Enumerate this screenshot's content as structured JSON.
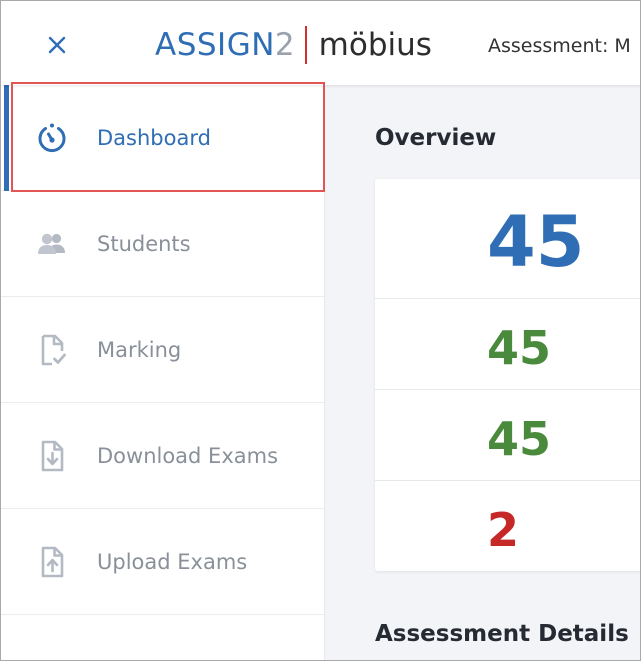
{
  "header": {
    "close_icon": "close-icon",
    "logo": {
      "assign_text": "ASSIGN",
      "assign_number": "2",
      "product_text": "möbius",
      "brand_blue": "#2f6db5",
      "divider_red": "#d32f2f"
    },
    "crumb": "Assessment: M"
  },
  "sidebar": {
    "active_color": "#2f6db5",
    "items": [
      {
        "label": "Dashboard",
        "icon": "dashboard-gauge-icon",
        "active": true
      },
      {
        "label": "Students",
        "icon": "students-group-icon",
        "active": false
      },
      {
        "label": "Marking",
        "icon": "marking-document-check-icon",
        "active": false
      },
      {
        "label": "Download Exams",
        "icon": "download-document-icon",
        "active": false
      },
      {
        "label": "Upload Exams",
        "icon": "upload-document-icon",
        "active": false
      }
    ]
  },
  "main": {
    "overview_title": "Overview",
    "stats": [
      {
        "value": "45",
        "color": "#2f6db5"
      },
      {
        "value": "45",
        "color": "#4a8a3c"
      },
      {
        "value": "45",
        "color": "#4a8a3c"
      },
      {
        "value": "2",
        "color": "#c62828"
      }
    ],
    "details_title": "Assessment Details"
  }
}
